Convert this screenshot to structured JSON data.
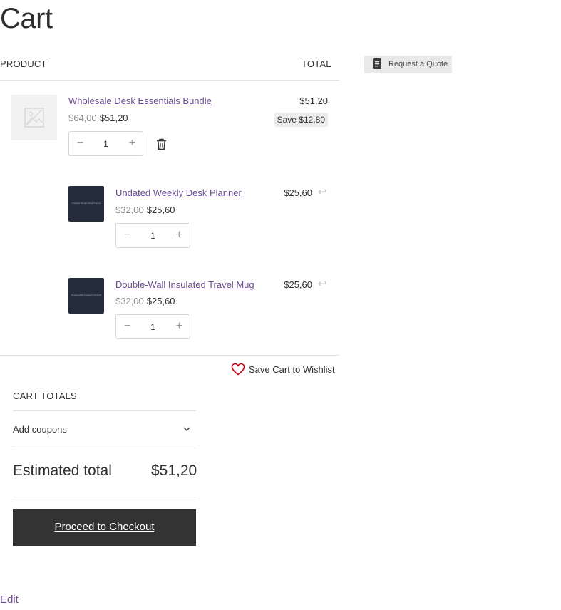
{
  "page": {
    "title": "Cart"
  },
  "table": {
    "product_header": "PRODUCT",
    "total_header": "TOTAL"
  },
  "quote": {
    "label": "Request a Quote",
    "icon": "document-icon"
  },
  "items": [
    {
      "name": "Wholesale Desk Essentials Bundle",
      "old_price": "$64,00",
      "price": "$51,20",
      "quantity": "1",
      "line_total": "$51,20",
      "save": "Save $12,80"
    },
    {
      "name": "Undated Weekly Desk Planner",
      "old_price": "$32,00",
      "price": "$25,60",
      "quantity": "1",
      "line_total": "$25,60"
    },
    {
      "name": "Double-Wall Insulated Travel Mug",
      "old_price": "$32,00",
      "price": "$25,60",
      "quantity": "1",
      "line_total": "$25,60"
    }
  ],
  "wishlist": {
    "label": "Save Cart to Wishlist"
  },
  "totals": {
    "header": "CART TOTALS",
    "coupons_label": "Add coupons",
    "estimated_label": "Estimated total",
    "estimated_value": "$51,20"
  },
  "checkout": {
    "label": "Proceed to Checkout"
  },
  "edit": {
    "label": "Edit"
  },
  "colors": {
    "link": "#6b4f8f",
    "button": "#333333",
    "heart": "#d0021b"
  }
}
